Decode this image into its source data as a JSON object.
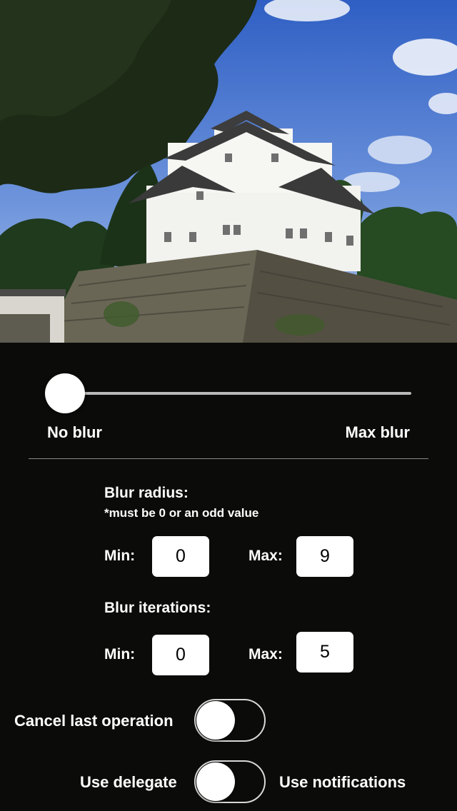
{
  "image": {
    "subject": "castle-photo"
  },
  "slider": {
    "value": 0,
    "min_label": "No blur",
    "max_label": "Max blur"
  },
  "blur_radius": {
    "title": "Blur radius:",
    "note": "*must be 0 or an odd value",
    "min_label": "Min:",
    "min_value": "0",
    "max_label": "Max:",
    "max_value": "9"
  },
  "blur_iterations": {
    "title": "Blur iterations:",
    "min_label": "Min:",
    "min_value": "0",
    "max_label": "Max:",
    "max_value": "5"
  },
  "cancel_toggle": {
    "label": "Cancel last operation",
    "on": false
  },
  "delegate_toggle": {
    "left_label": "Use delegate",
    "right_label": "Use notifications",
    "on": false
  },
  "colors": {
    "background": "#0b0b09",
    "track": "#b9b9b9",
    "control": "#ffffff"
  }
}
